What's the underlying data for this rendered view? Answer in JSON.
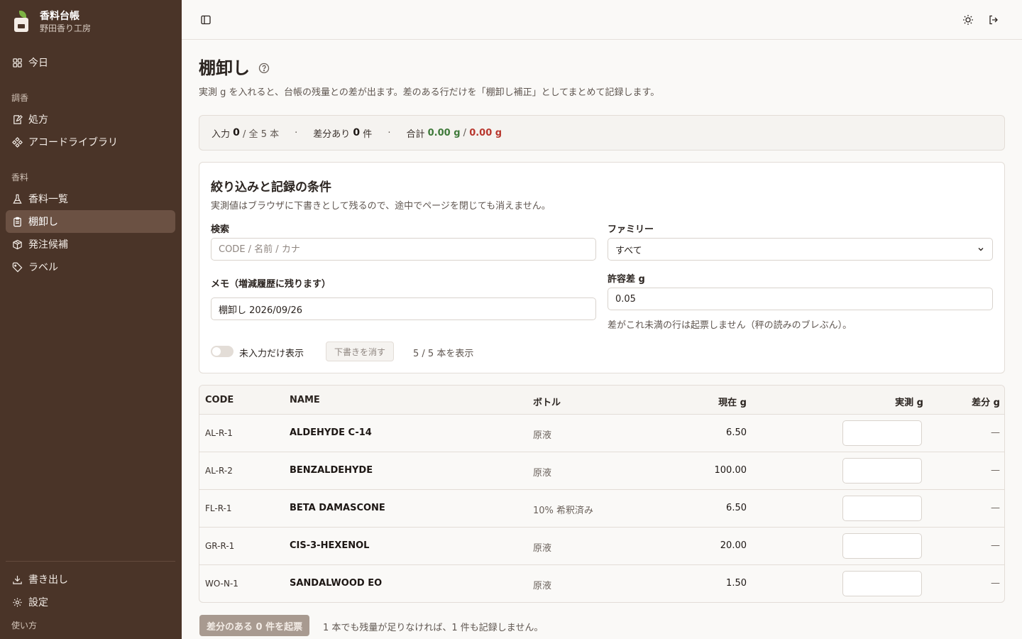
{
  "brand": {
    "title": "香料台帳",
    "subtitle": "野田香り工房"
  },
  "sidebar": {
    "today": "今日",
    "section_blend": "調香",
    "formulas": "処方",
    "accords": "アコードライブラリ",
    "section_materials": "香料",
    "materials": "香料一覧",
    "stocktake": "棚卸し",
    "reorder": "発注候補",
    "labels": "ラベル",
    "export": "書き出し",
    "settings": "設定",
    "help": "使い方"
  },
  "page": {
    "title": "棚卸し",
    "description": "実測 g を入れると、台帳の残量との差が出ます。差のある行だけを「棚卸し補正」としてまとめて記録します。"
  },
  "summary": {
    "input_label": "入力",
    "input_count": "0",
    "input_total": "/ 全 5 本",
    "diff_label": "差分あり",
    "diff_count": "0",
    "diff_unit": "件",
    "sum_label": "合計",
    "sum_plus": "0.00 g",
    "sum_slash": "/",
    "sum_minus": "0.00 g"
  },
  "conditions": {
    "title": "絞り込みと記録の条件",
    "description": "実測値はブラウザに下書きとして残るので、途中でページを閉じても消えません。",
    "search_label": "検索",
    "search_placeholder": "CODE / 名前 / カナ",
    "family_label": "ファミリー",
    "family_value": "すべて",
    "memo_label": "メモ（増減履歴に残ります）",
    "memo_value": "棚卸し 2026/09/26",
    "tolerance_label": "許容差 g",
    "tolerance_value": "0.05",
    "tolerance_hint": "差がこれ未満の行は起票しません（秤の読みのブレぶん）。",
    "toggle_label": "未入力だけ表示",
    "clear_draft": "下書きを消す",
    "showing": "5 / 5 本を表示"
  },
  "table": {
    "headers": {
      "code": "CODE",
      "name": "NAME",
      "bottle": "ボトル",
      "current": "現在 g",
      "measured": "実測 g",
      "diff": "差分 g"
    },
    "rows": [
      {
        "code": "AL-R-1",
        "name": "ALDEHYDE C-14",
        "bottle": "原液",
        "current": "6.50",
        "diff": "—"
      },
      {
        "code": "AL-R-2",
        "name": "BENZALDEHYDE",
        "bottle": "原液",
        "current": "100.00",
        "diff": "—"
      },
      {
        "code": "FL-R-1",
        "name": "BETA DAMASCONE",
        "bottle": "10% 希釈済み",
        "current": "6.50",
        "diff": "—"
      },
      {
        "code": "GR-R-1",
        "name": "CIS-3-HEXENOL",
        "bottle": "原液",
        "current": "20.00",
        "diff": "—"
      },
      {
        "code": "WO-N-1",
        "name": "SANDALWOOD EO",
        "bottle": "原液",
        "current": "1.50",
        "diff": "—"
      }
    ]
  },
  "footer": {
    "submit": "差分のある 0 件を起票",
    "note": "1 本でも残量が足りなければ、1 件も記録しません。"
  }
}
